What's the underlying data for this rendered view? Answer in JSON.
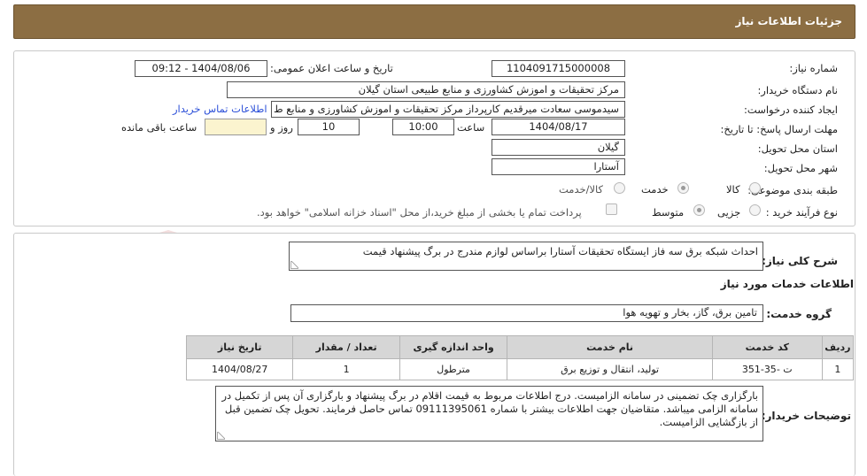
{
  "header": {
    "title": "جزئیات اطلاعات نیاز"
  },
  "watermark": {
    "text": "AriaTender.net"
  },
  "form": {
    "need_number": {
      "label": "شماره نیاز:",
      "value": "1104091715000008"
    },
    "announce_datetime": {
      "label": "تاریخ و ساعت اعلان عمومی:",
      "value": "1404/08/06 - 09:12"
    },
    "buyer_org": {
      "label": "نام دستگاه خریدار:",
      "value": "مرکز تحقیقات و اموزش کشاورزی و منابع طبیعی استان گیلان"
    },
    "requester": {
      "label": "ایجاد کننده درخواست:",
      "value": "سیدموسی سعادت میرقدیم کارپرداز مرکز تحقیقات و اموزش کشاورزی و منابع ط"
    },
    "buyer_contact_link": "اطلاعات تماس خریدار",
    "deadline": {
      "label": "مهلت ارسال پاسخ: تا تاریخ:",
      "date": "1404/08/17",
      "time_label": "ساعت",
      "time": "10:00",
      "days": "10",
      "days_label": "روز و",
      "remaining_value": "",
      "remaining_label": "ساعت باقی مانده"
    },
    "province": {
      "label": "استان محل تحویل:",
      "value": "گیلان"
    },
    "city": {
      "label": "شهر محل تحویل:",
      "value": "آستارا"
    },
    "category": {
      "label": "طبقه بندی موضوعی:",
      "options": [
        "کالا",
        "خدمت",
        "کالا/خدمت"
      ],
      "selected": "خدمت"
    },
    "purchase_type": {
      "label": "نوع فرآیند خرید :",
      "options": [
        "جزیی",
        "متوسط"
      ],
      "selected": "متوسط",
      "payment_note": "پرداخت تمام یا بخشی از مبلغ خرید،از محل \"اسناد خزانه اسلامی\" خواهد بود."
    }
  },
  "summary": {
    "label": "شرح کلی نیاز:",
    "value": "احداث شبکه برق سه فاز ایستگاه تحقیقات آستارا براساس لوازم مندرج در برگ پیشنهاد قیمت"
  },
  "services_info": {
    "title": "اطلاعات خدمات مورد نیاز",
    "group_label": "گروه خدمت:",
    "group_value": "تامین برق، گاز، بخار و تهویه هوا"
  },
  "table": {
    "headers": [
      "ردیف",
      "کد خدمت",
      "نام خدمت",
      "واحد اندازه گیری",
      "تعداد / مقدار",
      "تاریخ نیاز"
    ],
    "rows": [
      [
        "1",
        "ت -35-351",
        "تولید، انتقال و توزیع برق",
        "مترطول",
        "1",
        "1404/08/27"
      ]
    ]
  },
  "buyer_notes": {
    "label": "توضیحات خریدار:",
    "value": "بارگزاری چک تضمینی در سامانه الزامیست. درج اطلاعات مربوط به قیمت اقلام در برگ پیشنهاد و بارگزاری آن پس از تکمیل در سامانه الزامی میباشد. متقاضیان جهت اطلاعات بیشتر با شماره 09111395061 تماس حاصل فرمایند. تحویل چک تضمین قبل از بازگشایی الزامیست."
  }
}
